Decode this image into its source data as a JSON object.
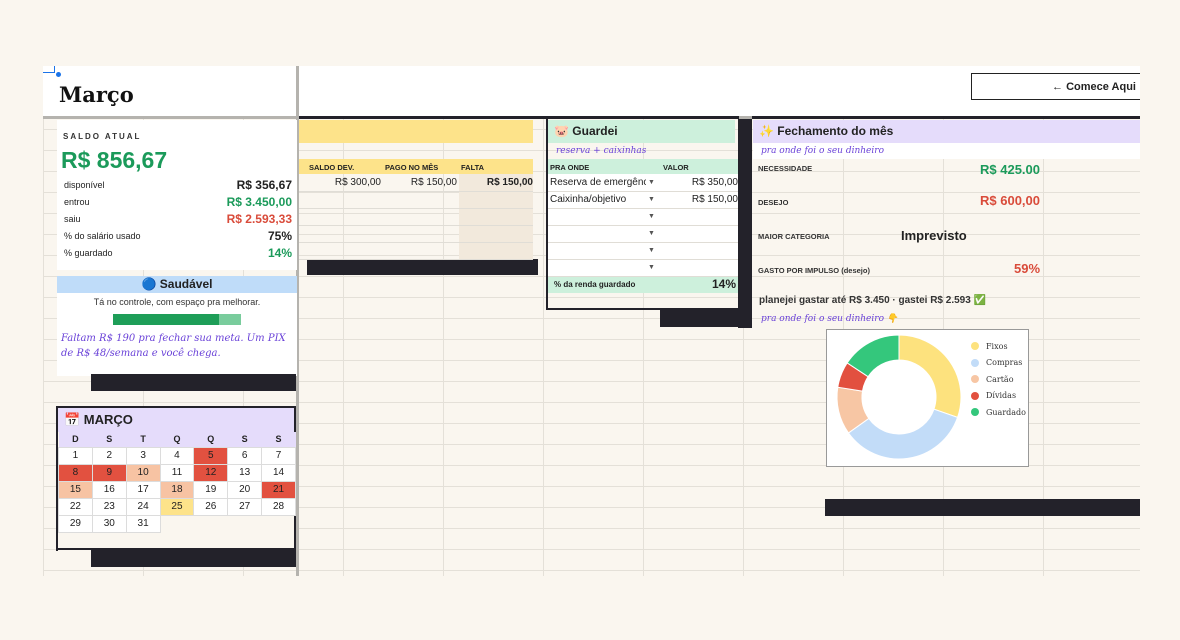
{
  "title": "Março",
  "comece": "← Comece Aqui",
  "saldo": {
    "label": "SALDO ATUAL",
    "value": "R$ 856,67",
    "rows": [
      {
        "label": "disponível",
        "value": "R$ 356,67"
      },
      {
        "label": "entrou",
        "value": "R$ 3.450,00"
      },
      {
        "label": "saiu",
        "value": "R$ 2.593,33"
      },
      {
        "label": "% do salário usado",
        "value": "75%"
      },
      {
        "label": "% guardado",
        "value": "14%"
      }
    ]
  },
  "health": {
    "title": "🔵 Saudável",
    "subtitle": "Tá no controle, com espaço pra melhorar.",
    "progress": 0.83,
    "note": "Faltam R$ 190 pra fechar sua meta. Um PIX de R$ 48/semana e você chega."
  },
  "calendar": {
    "title": "📅 MARÇO",
    "weekdays": [
      "D",
      "S",
      "T",
      "Q",
      "Q",
      "S",
      "S"
    ],
    "weeks": [
      [
        "1",
        "2",
        "3",
        "4",
        "5",
        "6",
        "7"
      ],
      [
        "8",
        "9",
        "10",
        "11",
        "12",
        "13",
        "14"
      ],
      [
        "15",
        "16",
        "17",
        "18",
        "19",
        "20",
        "21"
      ],
      [
        "22",
        "23",
        "24",
        "25",
        "26",
        "27",
        "28"
      ],
      [
        "29",
        "30",
        "31",
        "",
        "",
        "",
        ""
      ]
    ],
    "colors": {
      "red": "#e25140",
      "orange": "#f7c3a3",
      "yellow": "#fde38a",
      "white": "#ffffff"
    },
    "highlight": {
      "5": "red",
      "8": "red",
      "9": "red",
      "10": "orange",
      "12": "red",
      "15": "orange",
      "18": "orange",
      "21": "red",
      "25": "yellow"
    }
  },
  "debt": {
    "headers": [
      "SALDO DEV.",
      "PAGO NO MÊS",
      "FALTA"
    ],
    "rows": [
      [
        "R$ 300,00",
        "R$ 150,00",
        "R$ 150,00"
      ]
    ]
  },
  "guardei": {
    "title": "🐷 Guardei",
    "subtitle": "reserva + caixinhas",
    "headers": [
      "PRA ONDE",
      "VALOR"
    ],
    "rows": [
      [
        "Reserva de emergênc",
        "R$ 350,00"
      ],
      [
        "Caixinha/objetivo",
        "R$ 150,00"
      ]
    ],
    "footer_label": "% da renda guardado",
    "footer_value": "14%"
  },
  "fechamento": {
    "title": "✨ Fechamento do mês",
    "subtitle": "pra onde foi o seu dinheiro",
    "necessidade_label": "NECESSIDADE",
    "necessidade_value": "R$ 425.00",
    "desejo_label": "DESEJO",
    "desejo_value": "R$ 600,00",
    "maior_label": "MAIOR CATEGORIA",
    "maior_value": "Imprevisto",
    "impulso_label": "GASTO POR IMPULSO (desejo)",
    "impulso_value": "59%",
    "planejei": "planejei gastar até R$ 3.450 · gastei R$ 2.593 ✅",
    "subtitle2": "pra onde foi o seu dinheiro 👇"
  },
  "chart_data": {
    "type": "pie",
    "series": [
      {
        "name": "Fixos",
        "value": 27,
        "color": "#fde27e"
      },
      {
        "name": "Compras",
        "value": 31,
        "color": "#c2dcf8"
      },
      {
        "name": "Cartão",
        "value": 11,
        "color": "#f7c6a4"
      },
      {
        "name": "Dívidas",
        "value": 6,
        "color": "#e2503f"
      },
      {
        "name": "Guardado",
        "value": 14,
        "color": "#34c77c"
      }
    ],
    "legend": "right"
  }
}
